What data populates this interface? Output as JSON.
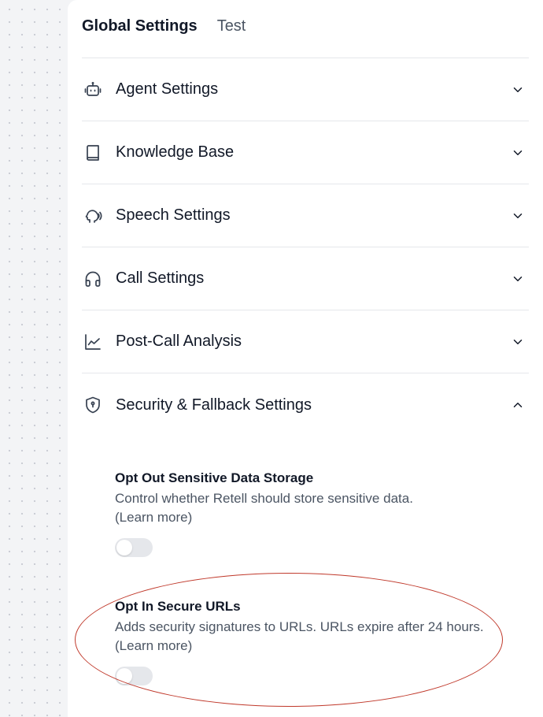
{
  "tabs": [
    {
      "label": "Global Settings"
    },
    {
      "label": "Test"
    }
  ],
  "sections": [
    {
      "label": "Agent Settings",
      "icon": "robot-icon"
    },
    {
      "label": "Knowledge Base",
      "icon": "book-icon"
    },
    {
      "label": "Speech Settings",
      "icon": "speech-head-icon"
    },
    {
      "label": "Call Settings",
      "icon": "headphones-icon"
    },
    {
      "label": "Post-Call Analysis",
      "icon": "line-chart-icon"
    },
    {
      "label": "Security & Fallback Settings",
      "icon": "shield-lock-icon",
      "expanded": true
    }
  ],
  "security": {
    "opt_out_storage": {
      "title": "Opt Out Sensitive Data Storage",
      "description": "Control whether Retell should store sensitive data.",
      "learn_more": "(Learn more)",
      "enabled": false
    },
    "secure_urls": {
      "title": "Opt In Secure URLs",
      "description": "Adds security signatures to URLs. URLs expire after 24 hours.",
      "learn_more": "(Learn more)",
      "enabled": false
    }
  },
  "colors": {
    "annotation": "#c0392b",
    "toggle_off": "#e5e7eb",
    "divider": "#e5e7eb"
  }
}
